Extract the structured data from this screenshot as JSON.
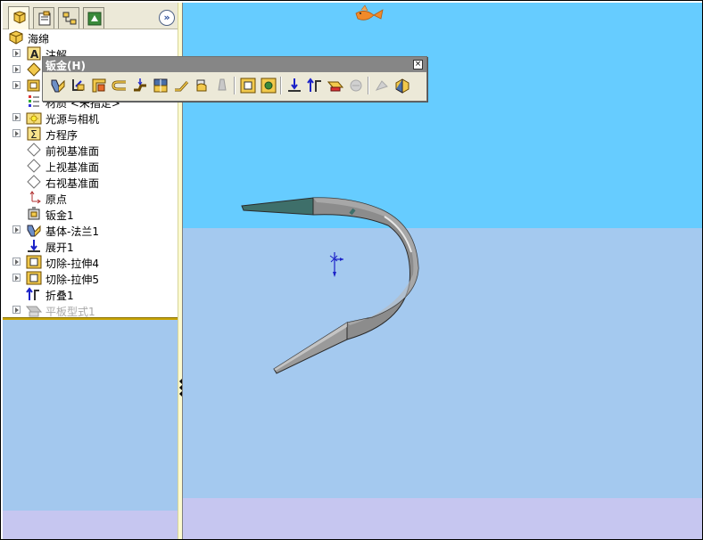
{
  "feature_manager": {
    "tabs": [
      {
        "name": "feature-tree",
        "icon": "feature-manager-icon"
      },
      {
        "name": "property",
        "icon": "property-manager-icon"
      },
      {
        "name": "configuration",
        "icon": "configuration-manager-icon"
      },
      {
        "name": "dimxpert",
        "icon": "dimxpert-icon"
      }
    ],
    "expand_glyph": "»",
    "tree": [
      {
        "label": "海绵",
        "icon": "part-icon"
      },
      {
        "label": "注解",
        "icon": "annotations-icon"
      },
      {
        "label": "",
        "icon": "material-icon"
      },
      {
        "label": "",
        "icon": "display-states-icon"
      },
      {
        "label": "材质 <未指定>",
        "icon": "material-unspecified-icon"
      },
      {
        "label": "光源与相机",
        "icon": "lights-cameras-icon"
      },
      {
        "label": "方程序",
        "icon": "equations-icon"
      },
      {
        "label": "前视基准面",
        "icon": "plane-icon"
      },
      {
        "label": "上视基准面",
        "icon": "plane-icon"
      },
      {
        "label": "右视基准面",
        "icon": "plane-icon"
      },
      {
        "label": "原点",
        "icon": "origin-icon"
      },
      {
        "label": "钣金1",
        "icon": "sheet-metal-icon"
      },
      {
        "label": "基体-法兰1",
        "icon": "base-flange-icon"
      },
      {
        "label": "展开1",
        "icon": "unfold-icon"
      },
      {
        "label": "切除-拉伸4",
        "icon": "cut-extrude-icon"
      },
      {
        "label": "切除-拉伸5",
        "icon": "cut-extrude-icon"
      },
      {
        "label": "折叠1",
        "icon": "fold-icon"
      },
      {
        "label": "平板型式1",
        "icon": "flat-pattern-icon"
      }
    ]
  },
  "toolbar": {
    "title": "钣金(H)",
    "close_glyph": "×",
    "buttons": [
      {
        "name": "base-flange",
        "icon": "base-flange-icon"
      },
      {
        "name": "convert-to-sheet-metal",
        "icon": "convert-icon"
      },
      {
        "name": "edge-flange",
        "icon": "edge-flange-icon"
      },
      {
        "name": "hem",
        "icon": "hem-icon"
      },
      {
        "name": "jog",
        "icon": "jog-icon"
      },
      {
        "name": "lofted-bend",
        "icon": "lofted-bend-icon"
      },
      {
        "name": "sketched-bend",
        "icon": "sketched-bend-icon"
      },
      {
        "name": "closed-corner",
        "icon": "closed-corner-icon"
      },
      {
        "name": "break-corner",
        "icon": "break-corner-icon"
      },
      {
        "name": "extruded-cut",
        "icon": "extruded-cut-icon"
      },
      {
        "name": "simple-hole",
        "icon": "simple-hole-icon"
      },
      {
        "name": "unfold",
        "icon": "unfold-icon"
      },
      {
        "name": "fold",
        "icon": "fold-icon"
      },
      {
        "name": "flatten",
        "icon": "flatten-icon"
      },
      {
        "name": "no-bends",
        "icon": "no-bends-icon"
      },
      {
        "name": "rip",
        "icon": "rip-icon"
      },
      {
        "name": "insert-bends",
        "icon": "insert-bends-icon"
      }
    ]
  },
  "viewport": {
    "background_top": "#66ccff",
    "background_mid": "#a4c9ef",
    "background_bottom": "#c6c6f0",
    "part_color": "#8c8c8c",
    "triad_color": "#1b22c8",
    "fish_color": "#f08a2a"
  }
}
